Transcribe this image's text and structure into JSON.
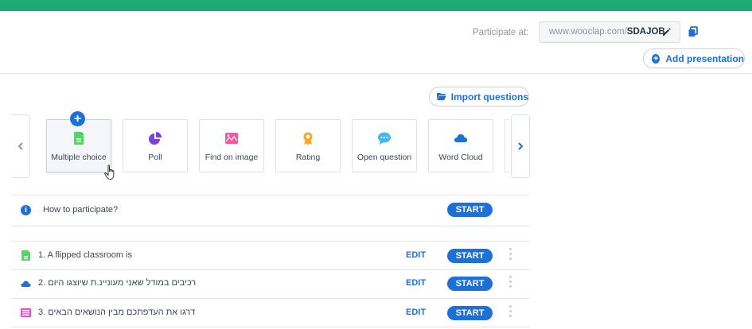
{
  "header": {
    "participate_label": "Participate at:",
    "url_prefix": "www.wooclap.com/",
    "event_code": "SDAJOB",
    "add_presentation_label": "Add presentation",
    "accent_color": "#1fa977"
  },
  "toolbar": {
    "import_label": "Import questions"
  },
  "question_types": [
    {
      "label": "Multiple choice",
      "icon": "multiple-choice-icon",
      "color": "#4cd964"
    },
    {
      "label": "Poll",
      "icon": "poll-icon",
      "color": "#7b3fe4"
    },
    {
      "label": "Find on image",
      "icon": "find-on-image-icon",
      "color": "#f25a9b"
    },
    {
      "label": "Rating",
      "icon": "rating-icon",
      "color": "#f5a623"
    },
    {
      "label": "Open question",
      "icon": "open-question-icon",
      "color": "#43b9f0"
    },
    {
      "label": "Word Cloud",
      "icon": "word-cloud-icon",
      "color": "#1d70d6"
    }
  ],
  "how_to_participate": {
    "label": "How to participate?",
    "start_label": "START"
  },
  "questions": [
    {
      "text": "1. A flipped classroom is",
      "icon": "multiple-choice-icon",
      "edit_label": "EDIT",
      "start_label": "START"
    },
    {
      "text": "רכיבים במודל שאני מעוניינ.ת שיוצגו היום .2",
      "icon": "word-cloud-icon",
      "edit_label": "EDIT",
      "start_label": "START"
    },
    {
      "text": "דרגו את העדפתכם מבין הנושאים הבאים .3",
      "icon": "ranking-icon",
      "edit_label": "EDIT",
      "start_label": "START"
    }
  ]
}
